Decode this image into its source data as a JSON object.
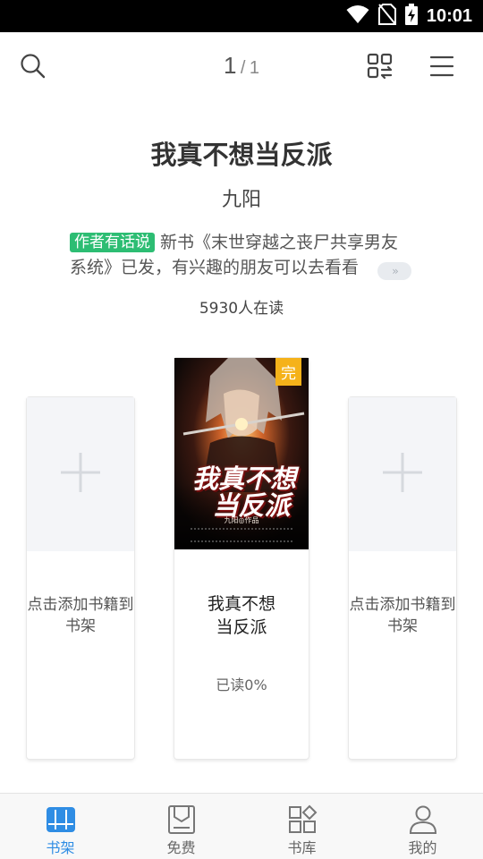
{
  "status_bar": {
    "time": "10:01",
    "icons": [
      "wifi-icon",
      "no-sim-icon",
      "battery-charging-icon"
    ]
  },
  "toolbar": {
    "page_current": "1",
    "page_separator": "/",
    "page_total": "1",
    "icons": [
      "search-icon",
      "scan-switch-icon",
      "menu-icon"
    ]
  },
  "book": {
    "title": "我真不想当反派",
    "author": "九阳",
    "notice_badge": "作者有话说",
    "notice_text": "新书《末世穿越之丧尸共享男友系统》已发，有兴趣的朋友可以去看看",
    "notice_more": "››",
    "reader_count": "5930人在读"
  },
  "shelf": {
    "left_slot": {
      "label": "点击添加书籍到书架"
    },
    "right_slot": {
      "label": "点击添加书籍到书架"
    },
    "center_book": {
      "cover_title_line1": "我真不想",
      "cover_title_line2": "当反派",
      "cover_author": "九阳◎作品",
      "status_tag": "完",
      "title_line1": "我真不想",
      "title_line2": "当反派",
      "progress": "已读0%",
      "read_fraction": 0
    }
  },
  "bottom_nav": {
    "items": [
      {
        "label": "书架",
        "icon": "bookshelf-icon",
        "active": true
      },
      {
        "label": "免费",
        "icon": "free-bookmark-icon",
        "active": false
      },
      {
        "label": "书库",
        "icon": "library-grid-icon",
        "active": false
      },
      {
        "label": "我的",
        "icon": "profile-icon",
        "active": false
      }
    ]
  },
  "colors": {
    "accent": "#2f8de4",
    "badge": "#2dbd73",
    "status_tag": "#f5b21a"
  }
}
